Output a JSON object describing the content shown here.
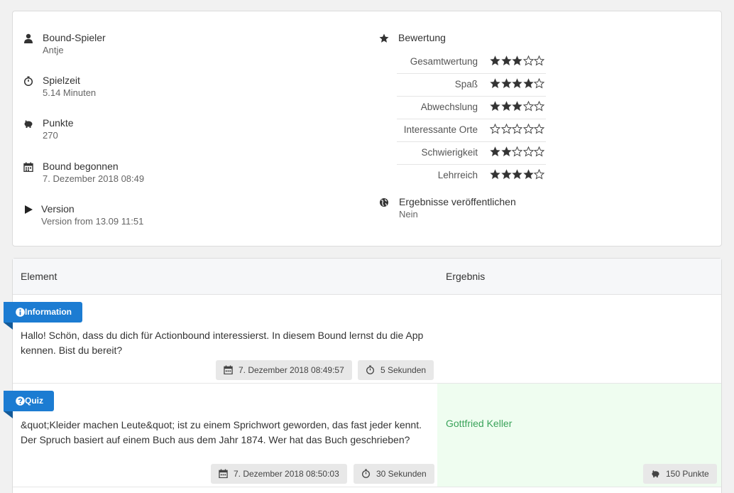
{
  "summary": {
    "player_title": "Bound-Spieler",
    "player_value": "Antje",
    "playtime_title": "Spielzeit",
    "playtime_value": "5.14 Minuten",
    "points_title": "Punkte",
    "points_value": "270",
    "started_title": "Bound begonnen",
    "started_value": "7. Dezember 2018 08:49",
    "version_title": "Version",
    "version_value": "Version from 13.09 11:51",
    "rating_title": "Bewertung",
    "ratings": [
      {
        "label": "Gesamtwertung",
        "stars": 3
      },
      {
        "label": "Spaß",
        "stars": 4
      },
      {
        "label": "Abwechslung",
        "stars": 3
      },
      {
        "label": "Interessante Orte",
        "stars": 0
      },
      {
        "label": "Schwierigkeit",
        "stars": 2
      },
      {
        "label": "Lehrreich",
        "stars": 4
      }
    ],
    "max_stars": 5,
    "publish_title": "Ergebnisse veröffentlichen",
    "publish_value": "Nein"
  },
  "table": {
    "col_element": "Element",
    "col_result": "Ergebnis",
    "rows": [
      {
        "badge": "Information",
        "badge_icon": "info-circle-icon",
        "text": "Hallo! Schön, dass du dich für Actionbound interessierst. In diesem Bound lernst du die App kennen. Bist du bereit?",
        "timestamp": "7. Dezember 2018 08:49:57",
        "duration": "5 Sekunden"
      },
      {
        "badge": "Quiz",
        "badge_icon": "question-circle-icon",
        "text": "&quot;Kleider machen Leute&quot; ist zu einem Sprichwort geworden, das fast jeder kennt. Der Spruch basiert auf einem Buch aus dem Jahr 1874. Wer hat das Buch geschrieben?",
        "timestamp": "7. Dezember 2018 08:50:03",
        "duration": "30 Sekunden",
        "answer": "Gottfried Keller",
        "points": "150 Punkte"
      }
    ]
  },
  "colors": {
    "accent": "#1c7cd2",
    "correct_bg": "#effdf0",
    "correct_text": "#3aa35a"
  }
}
